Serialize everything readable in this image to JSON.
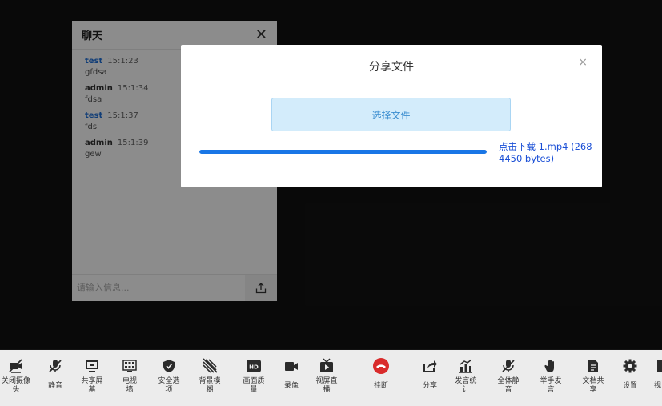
{
  "chat": {
    "title": "聊天",
    "close_symbol": "✕",
    "messages": [
      {
        "user": "test",
        "time": "15:1:23",
        "text": "gfdsa"
      },
      {
        "user": "admin",
        "time": "15:1:34",
        "text": "fdsa"
      },
      {
        "user": "test",
        "time": "15:1:37",
        "text": "fds"
      },
      {
        "user": "admin",
        "time": "15:1:39",
        "text": "gew"
      }
    ],
    "input_placeholder": "请输入信息..."
  },
  "share_modal": {
    "title": "分享文件",
    "close_symbol": "×",
    "choose_label": "选择文件",
    "progress_percent": 100,
    "download_link": "点击下载 1.mp4 (2684450 bytes)"
  },
  "toolbar": {
    "items": [
      {
        "label": "关闭摄像头",
        "icon": "camera-off-icon"
      },
      {
        "label": "静音",
        "icon": "mic-off-icon"
      },
      {
        "label": "共享屏幕",
        "icon": "monitor-icon"
      },
      {
        "label": "电视墙",
        "icon": "grid-icon"
      },
      {
        "label": "安全选项",
        "icon": "shield-icon"
      },
      {
        "label": "背景模糊",
        "icon": "stripes-icon"
      },
      {
        "label": "画面质量",
        "icon": "hd-icon"
      },
      {
        "label": "录像",
        "icon": "video-record-icon"
      },
      {
        "label": "视屏直播",
        "icon": "live-tv-icon"
      },
      {
        "label": "挂断",
        "icon": "hangup-icon"
      },
      {
        "label": "分享",
        "icon": "share-icon"
      },
      {
        "label": "发言统计",
        "icon": "stats-icon"
      },
      {
        "label": "全体静音",
        "icon": "mute-all-icon"
      },
      {
        "label": "举手发言",
        "icon": "raise-hand-icon"
      },
      {
        "label": "文档共享",
        "icon": "document-icon"
      },
      {
        "label": "设置",
        "icon": "settings-icon"
      },
      {
        "label": "视",
        "icon": "more-icon"
      }
    ]
  },
  "colors": {
    "background": "#121212",
    "accent": "#1976e6",
    "hangup": "#d92b2b",
    "link": "#1a4fd6"
  }
}
